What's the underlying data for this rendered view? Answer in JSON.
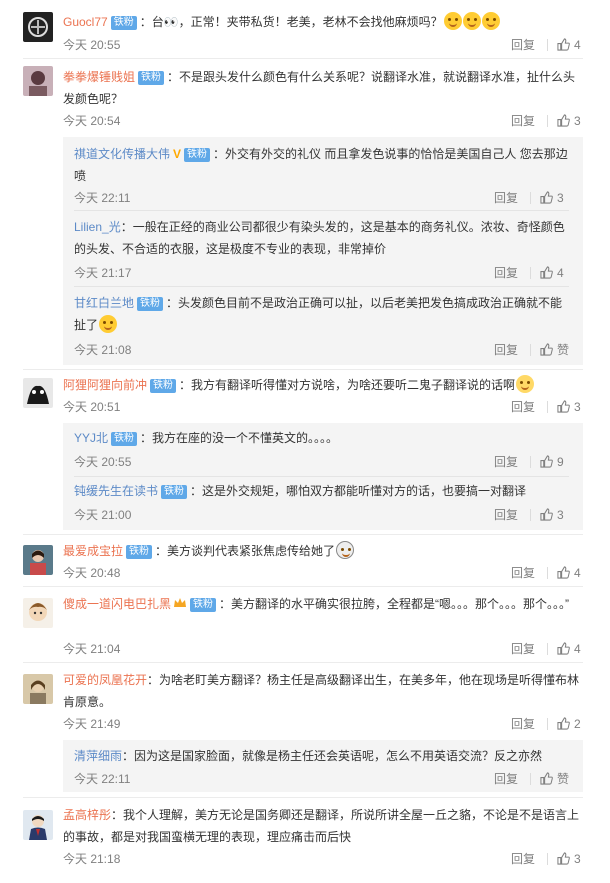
{
  "comments": [
    {
      "user": "Guocl77",
      "badge": "铁粉",
      "text": "：台👀，正常！夹带私货！老美，老林不会找他麻烦吗？",
      "time": "今天 20:55",
      "reply": "回复",
      "likes": "4"
    },
    {
      "user": "拳拳爆锤贱姐",
      "badge": "铁粉",
      "text": "：不是跟头发什么颜色有什么关系呢？说翻译水准，就说翻译水准，扯什么头发颜色呢？",
      "time": "今天 20:54",
      "reply": "回复",
      "likes": "3",
      "replies": [
        {
          "user": "祺道文化传播大伟",
          "badge": "铁粉",
          "text": "：外交有外交的礼仪 而且拿发色说事的恰恰是美国自己人 您去那边喷",
          "time": "今天 22:11",
          "reply": "回复",
          "likes": "3"
        },
        {
          "user": "Lilien_光",
          "text": "：一般在正经的商业公司都很少有染头发的，这是基本的商务礼仪。浓妆、奇怪颜色的头发、不合适的衣服，这是极度不专业的表现，非常掉价",
          "time": "今天 21:17",
          "reply": "回复",
          "likes": "4"
        },
        {
          "user": "甘红白兰地",
          "badge": "铁粉",
          "text": "：头发颜色目前不是政治正确可以扯，以后老美把发色搞成政治正确就不能扯了",
          "time": "今天 21:08",
          "reply": "回复",
          "likes": "赞"
        }
      ]
    },
    {
      "user": "阿狸阿狸向前冲",
      "badge": "铁粉",
      "text": "：我方有翻译听得懂对方说啥，为啥还要听二鬼子翻译说的话啊",
      "time": "今天 20:51",
      "reply": "回复",
      "likes": "3",
      "replies": [
        {
          "user": "YYJ北",
          "badge": "铁粉",
          "text": "：我方在座的没一个不懂英文的。。。。",
          "time": "今天 20:55",
          "reply": "回复",
          "likes": "9"
        },
        {
          "user": "钝缓先生在读书",
          "badge": "铁粉",
          "text": "：这是外交规矩，哪怕双方都能听懂对方的话，也要搞一对翻译",
          "time": "今天 21:00",
          "reply": "回复",
          "likes": "3"
        }
      ]
    },
    {
      "user": "最爱成宝拉",
      "badge": "铁粉",
      "text": "：美方谈判代表紧张焦虑传给她了",
      "time": "今天 20:48",
      "reply": "回复",
      "likes": "4"
    },
    {
      "user": "傻成一道闪电巴扎黑",
      "badge": "铁粉",
      "text": "：美方翻译的水平确实很拉胯，全程都是“嗯。。。那个。。。那个。。。”",
      "time": "今天 21:04",
      "reply": "回复",
      "likes": "4"
    },
    {
      "user": "可爱的凤凰花开",
      "text": "：为啥老盯美方翻译？杨主任是高级翻译出生，在美多年，他在现场是听得懂布林肯原意。",
      "time": "今天 21:49",
      "reply": "回复",
      "likes": "2",
      "replies": [
        {
          "user": "清萍细雨",
          "text": "：因为这是国家脸面，就像是杨主任还会英语呢，怎么不用英语交流？反之亦然",
          "time": "今天 22:11",
          "reply": "回复",
          "likes": "赞"
        }
      ]
    },
    {
      "user": "孟高梓彤",
      "text": "：我个人理解，美方无论是国务卿还是翻译，所说所讲全屋一丘之貉，不论是不是语言上的事故，都是对我国蛮横无理的表现，理应痛击而后快",
      "time": "今天 21:18",
      "reply": "回复",
      "likes": "3"
    }
  ],
  "icons": {
    "like": "thumbs-up-icon",
    "vip": "v-verified-icon",
    "crown": "crown-fan-icon"
  },
  "colors": {
    "username": "#eb7350",
    "reply_username": "#5c8ac7",
    "badge": "#5fa8e8",
    "meta": "#808080"
  }
}
